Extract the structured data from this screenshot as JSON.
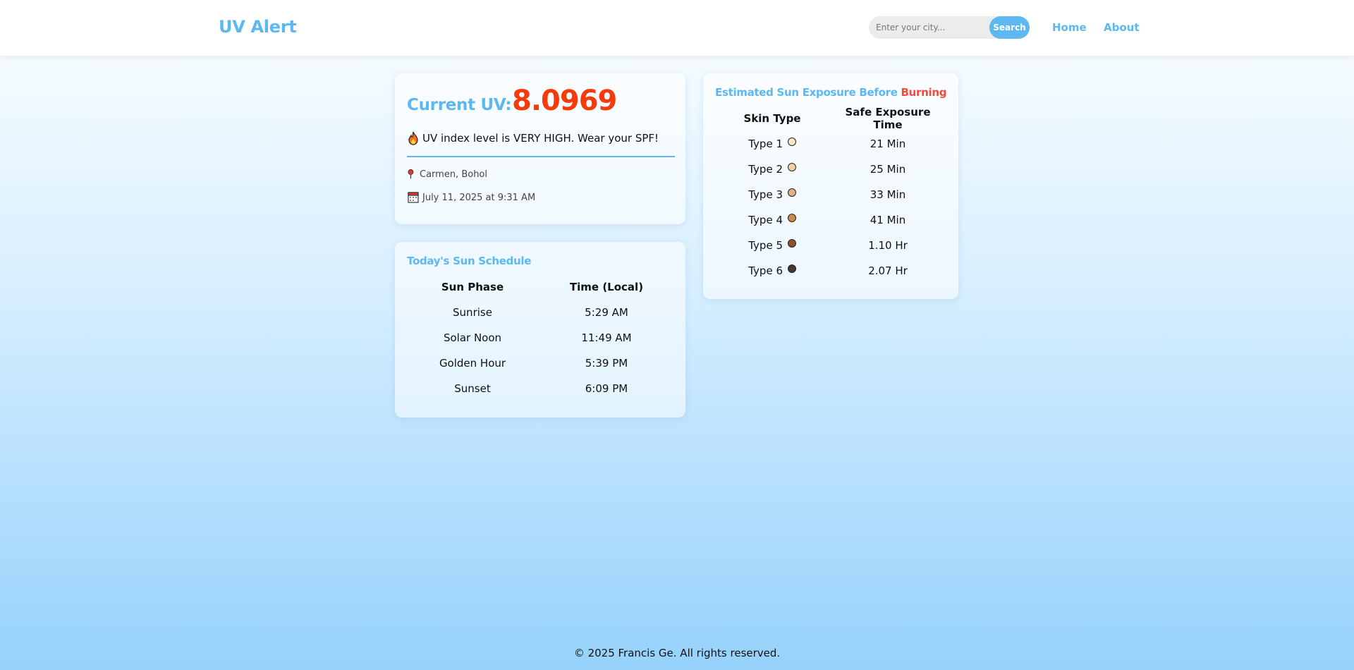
{
  "header": {
    "logo": "UV Alert",
    "search_placeholder": "Enter your city...",
    "search_button": "Search",
    "nav": {
      "home": "Home",
      "about": "About"
    }
  },
  "uv_card": {
    "label": "Current UV:",
    "value": "8.0969",
    "message": "UV index level is VERY HIGH. Wear your SPF!",
    "location": "Carmen, Bohol",
    "datetime": "July 11, 2025 at 9:31 AM",
    "icons": {
      "message": "fire-icon",
      "location": "pin-icon",
      "date": "calendar-icon"
    }
  },
  "sun_schedule": {
    "title": "Today's Sun Schedule",
    "headers": [
      "Sun Phase",
      "Time (Local)"
    ],
    "rows": [
      {
        "phase": "Sunrise",
        "time": "5:29 AM"
      },
      {
        "phase": "Solar Noon",
        "time": "11:49 AM"
      },
      {
        "phase": "Golden Hour",
        "time": "5:39 PM"
      },
      {
        "phase": "Sunset",
        "time": "6:09 PM"
      }
    ]
  },
  "exposure": {
    "title_prefix": "Estimated Sun Exposure Before",
    "title_highlight": "Burning",
    "headers": [
      "Skin Type",
      "Safe Exposure Time"
    ],
    "rows": [
      {
        "type": "Type 1",
        "time": "21 Min",
        "color": "#fbe7c6"
      },
      {
        "type": "Type 2",
        "time": "25 Min",
        "color": "#f4cfa4"
      },
      {
        "type": "Type 3",
        "time": "33 Min",
        "color": "#e0b189"
      },
      {
        "type": "Type 4",
        "time": "41 Min",
        "color": "#c98a4b"
      },
      {
        "type": "Type 5",
        "time": "1.10 Hr",
        "color": "#8e5128"
      },
      {
        "type": "Type 6",
        "time": "2.07 Hr",
        "color": "#4b3530"
      }
    ]
  },
  "footer": {
    "text": "© 2025 Francis Ge. All rights reserved."
  },
  "colors": {
    "accent": "#5db8f1",
    "uv_value": "#f53a0c",
    "burning": "#f04b3b"
  }
}
